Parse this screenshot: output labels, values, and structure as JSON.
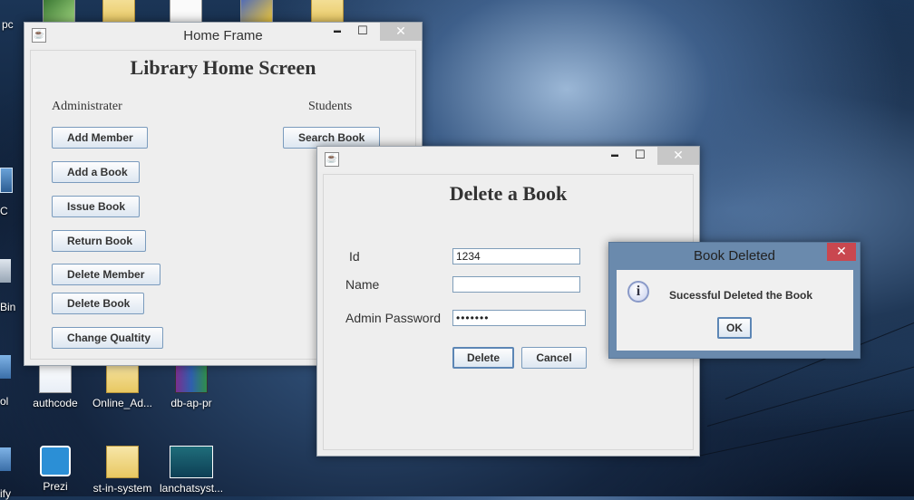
{
  "desktop": {
    "top_left_label": "pc",
    "left_edge_labels": [
      "C",
      "Bin",
      "ol",
      "ify"
    ],
    "icons": [
      {
        "label": "authcode",
        "icon": "notepad-icon"
      },
      {
        "label": "Online_Ad...",
        "icon": "folder-icon"
      },
      {
        "label": "db-ap-pr",
        "icon": "winrar-icon"
      },
      {
        "label": "Prezi",
        "icon": "prezi-icon"
      },
      {
        "label": "st-in-system",
        "icon": "folder-icon"
      },
      {
        "label": "lanchatsyst...",
        "icon": "powerpoint-icon"
      }
    ]
  },
  "home_frame": {
    "title": "Home Frame",
    "heading": "Library Home Screen",
    "admin_label": "Administrater",
    "students_label": "Students",
    "admin_buttons": [
      "Add Member",
      "Add a Book",
      "Issue Book",
      "Return Book",
      "Delete Member",
      "Delete Book",
      "Change Qualtity"
    ],
    "student_buttons": [
      "Search Book"
    ]
  },
  "delete_frame": {
    "title": "",
    "heading": "Delete a Book",
    "id_label": "Id",
    "id_value": "1234",
    "name_label": "Name",
    "name_value": "",
    "password_label": "Admin Password",
    "password_value": "•••••••",
    "delete_label": "Delete",
    "cancel_label": "Cancel"
  },
  "dialog": {
    "title": "Book Deleted",
    "message": "Sucessful Deleted the Book",
    "ok_label": "OK",
    "info_glyph": "i"
  },
  "window_controls": {
    "minimize": "▬",
    "maximize": "☐",
    "close": "✕"
  },
  "colors": {
    "close_active": "#c9474f",
    "button_border": "#7a9bbd"
  }
}
